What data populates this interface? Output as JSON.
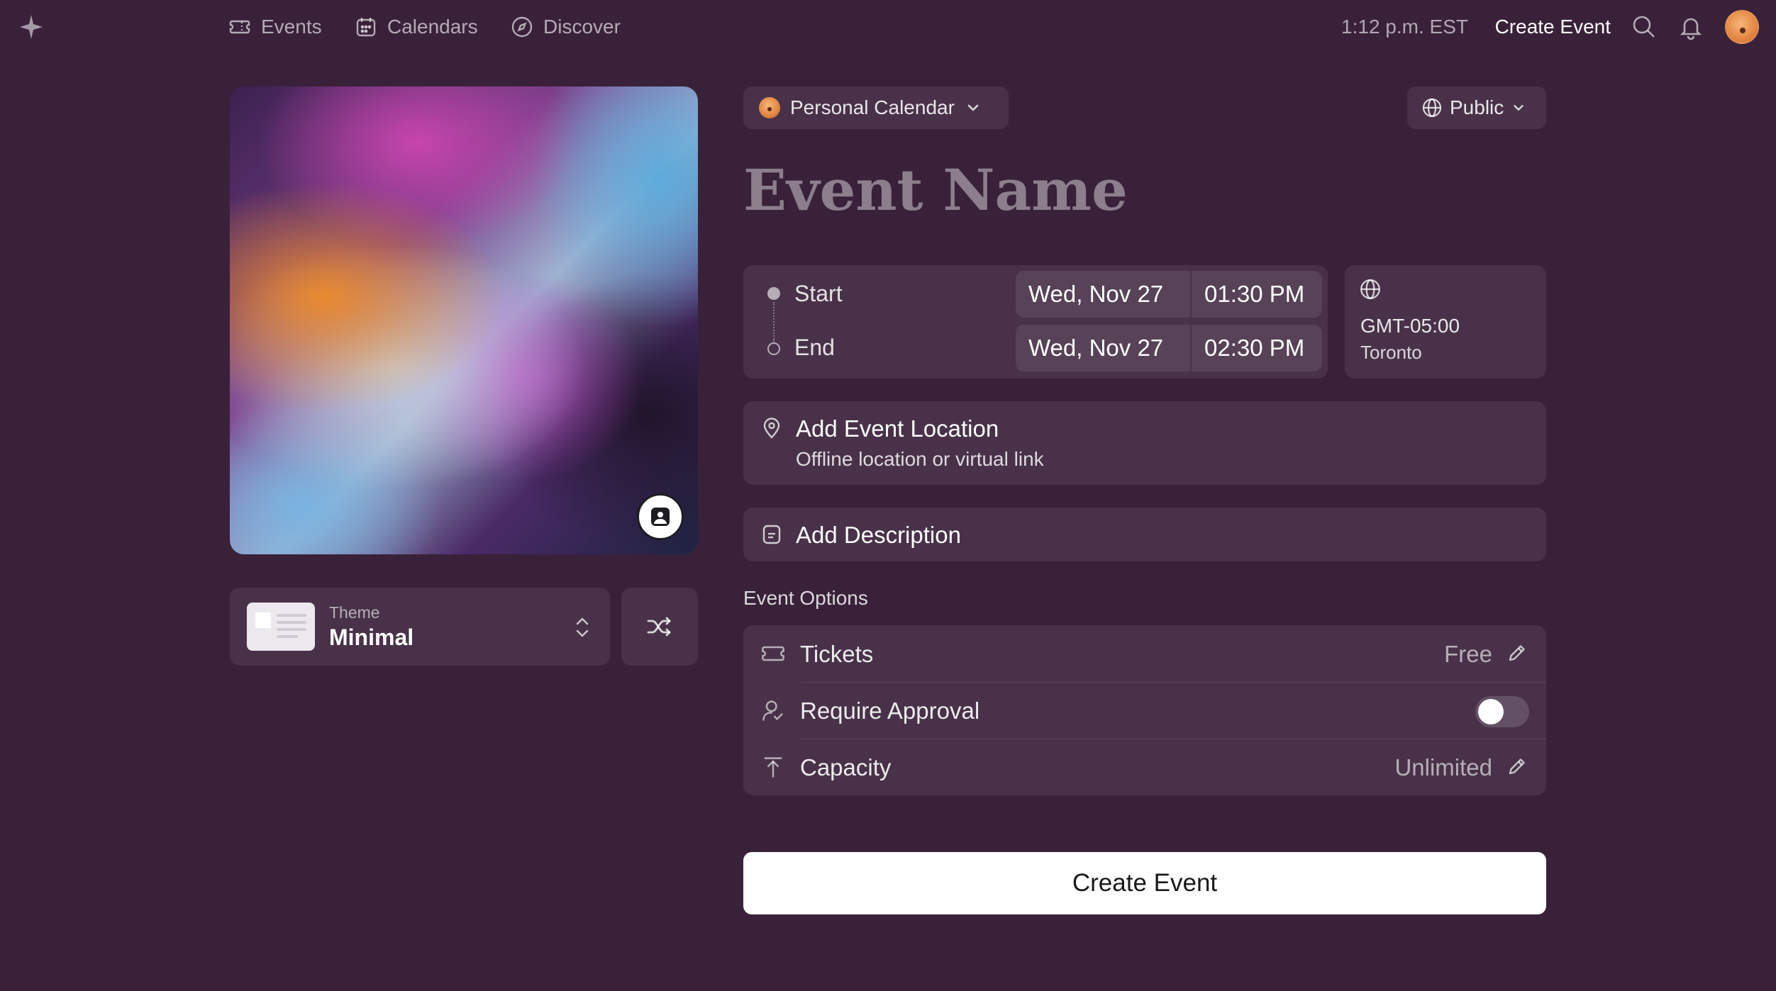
{
  "nav": {
    "links": [
      {
        "label": "Events",
        "icon": "ticket-icon"
      },
      {
        "label": "Calendars",
        "icon": "calendar-icon"
      },
      {
        "label": "Discover",
        "icon": "compass-icon"
      }
    ],
    "time": "1:12 p.m. EST",
    "create_label": "Create Event"
  },
  "theme": {
    "label": "Theme",
    "value": "Minimal"
  },
  "calendar_selector": {
    "label": "Personal Calendar"
  },
  "visibility": {
    "label": "Public"
  },
  "event_name": {
    "placeholder": "Event Name"
  },
  "datetime": {
    "start_label": "Start",
    "end_label": "End",
    "start_date": "Wed, Nov 27",
    "start_time": "01:30 PM",
    "end_date": "Wed, Nov 27",
    "end_time": "02:30 PM"
  },
  "timezone": {
    "offset": "GMT-05:00",
    "city": "Toronto"
  },
  "location": {
    "title": "Add Event Location",
    "subtitle": "Offline location or virtual link"
  },
  "description": {
    "title": "Add Description"
  },
  "options": {
    "title": "Event Options",
    "tickets": {
      "label": "Tickets",
      "value": "Free"
    },
    "approval": {
      "label": "Require Approval",
      "enabled": false
    },
    "capacity": {
      "label": "Capacity",
      "value": "Unlimited"
    }
  },
  "submit": {
    "label": "Create Event"
  },
  "colors": {
    "background": "#3a213a",
    "button": "#ffffff"
  }
}
